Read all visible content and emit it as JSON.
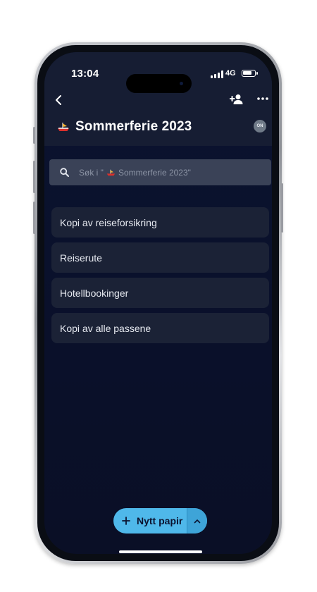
{
  "status_bar": {
    "time": "13:04",
    "network": "4G"
  },
  "header": {
    "title": "Sommerferie 2023",
    "badge": "ON",
    "icons": {
      "back": "chevron-left-icon",
      "add_user": "add-user-icon",
      "more": "more-horizontal-icon",
      "emoji": "boat-emoji-icon"
    }
  },
  "search": {
    "placeholder_prefix": "Søk i \"",
    "placeholder_name": "Sommerferie 2023\""
  },
  "papers": [
    {
      "label": "Kopi av reiseforsikring"
    },
    {
      "label": "Reiserute"
    },
    {
      "label": "Hotellbookinger"
    },
    {
      "label": "Kopi av alle passene"
    }
  ],
  "fab": {
    "label": "Nytt papir"
  },
  "colors": {
    "accent": "#4fb8ea",
    "background": "#0b1330",
    "header": "#161d33",
    "card": "#1b2236"
  }
}
